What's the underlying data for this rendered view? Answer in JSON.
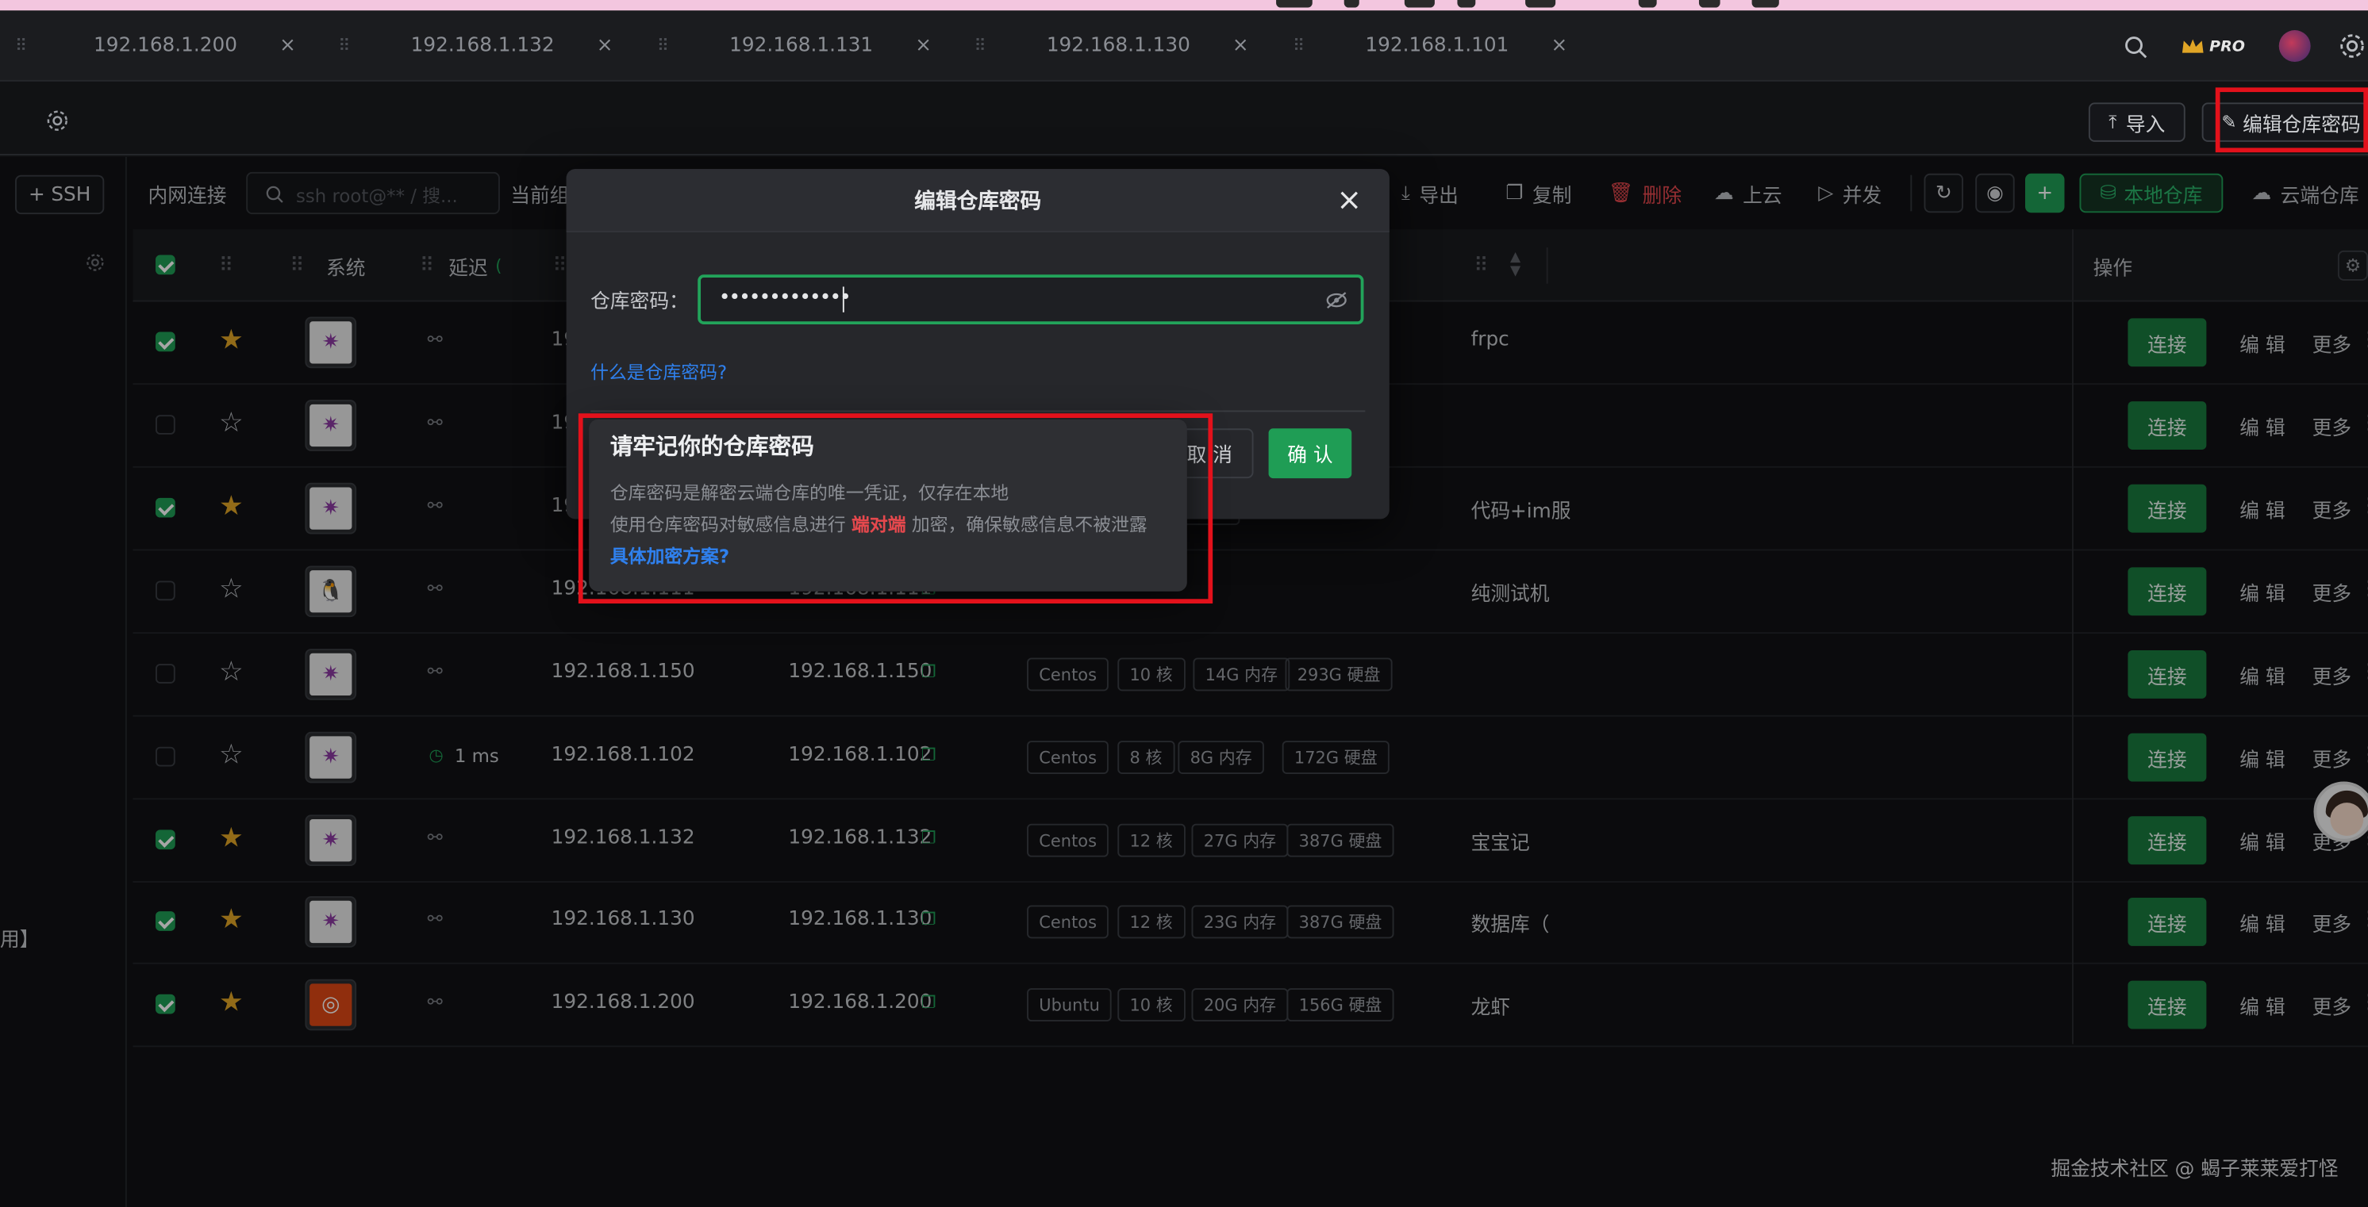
{
  "tabs": [
    {
      "label": "192.168.1.200"
    },
    {
      "label": "192.168.1.132"
    },
    {
      "label": "192.168.1.131"
    },
    {
      "label": "192.168.1.130"
    },
    {
      "label": "192.168.1.101"
    }
  ],
  "tab_close": "×",
  "topbar": {
    "pro_badge": "PRO",
    "import_label": "导入",
    "edit_pwd_label": "编辑仓库密码"
  },
  "left": {
    "ssh_button": "SSH",
    "partial_text": "用】"
  },
  "toolbar": {
    "intranet_label": "内网连接",
    "search_placeholder": "ssh root@** / 搜...",
    "group_label": "当前组",
    "export_label": "导出",
    "copy_label": "复制",
    "delete_label": "删除",
    "cloud_up_label": "上云",
    "concurrent_label": "并发",
    "local_repo_label": "本地仓库",
    "cloud_repo_label": "云端仓库"
  },
  "table": {
    "headers": {
      "system": "系统",
      "latency": "延迟",
      "operation": "操作"
    },
    "rows": [
      {
        "checked": true,
        "starred": true,
        "os": "CentOS",
        "latency": "",
        "host": "19",
        "ip": "",
        "tags": [],
        "note": "frpc"
      },
      {
        "checked": false,
        "starred": false,
        "os": "CentOS",
        "latency": "",
        "host": "19",
        "ip": "",
        "tags": [],
        "note": ""
      },
      {
        "checked": true,
        "starred": true,
        "os": "CentOS",
        "latency": "",
        "host": "192",
        "ip": "",
        "tags": [
          "39G 内存",
          "387G 硬盘"
        ],
        "note": "代码+im服"
      },
      {
        "checked": false,
        "starred": false,
        "os": "Linux",
        "latency": "",
        "host": "192.168.1.111",
        "ip": "192.168.1.111",
        "tags": [],
        "note": "纯测试机"
      },
      {
        "checked": false,
        "starred": false,
        "os": "CentOS",
        "latency": "",
        "host": "192.168.1.150",
        "ip": "192.168.1.150",
        "tags": [
          "Centos",
          "10 核",
          "14G 内存",
          "293G 硬盘"
        ],
        "note": ""
      },
      {
        "checked": false,
        "starred": false,
        "os": "CentOS",
        "latency": "1 ms",
        "host": "192.168.1.102",
        "ip": "192.168.1.102",
        "tags": [
          "Centos",
          "8 核",
          "8G 内存",
          "172G 硬盘"
        ],
        "note": ""
      },
      {
        "checked": true,
        "starred": true,
        "os": "CentOS",
        "latency": "",
        "host": "192.168.1.132",
        "ip": "192.168.1.132",
        "tags": [
          "Centos",
          "12 核",
          "27G 内存",
          "387G 硬盘"
        ],
        "note": "宝宝记"
      },
      {
        "checked": true,
        "starred": true,
        "os": "CentOS",
        "latency": "",
        "host": "192.168.1.130",
        "ip": "192.168.1.130",
        "tags": [
          "Centos",
          "12 核",
          "23G 内存",
          "387G 硬盘"
        ],
        "note": "数据库（"
      },
      {
        "checked": true,
        "starred": true,
        "os": "Ubuntu",
        "latency": "",
        "host": "192.168.1.200",
        "ip": "192.168.1.200",
        "tags": [
          "Ubuntu",
          "10 核",
          "20G 内存",
          "156G 硬盘"
        ],
        "note": "龙虾"
      }
    ],
    "connect_label": "连接",
    "edit_label": "编 辑",
    "more_label": "更多"
  },
  "modal": {
    "title": "编辑仓库密码",
    "close": "×",
    "pwd_label": "仓库密码：",
    "pwd_value": "•••••••••••••",
    "help_link": "什么是仓库密码?",
    "cancel_label": "取 消",
    "confirm_label": "确 认"
  },
  "popover": {
    "title": "请牢记你的仓库密码",
    "line1": "仓库密码是解密云端仓库的唯一凭证，仅存在本地",
    "line2_pre": "使用仓库密码对敏感信息进行",
    "line2_hl": "端对端",
    "line2_post": "加密，确保敏感信息不被泄露",
    "link": "具体加密方案?"
  },
  "watermark": "掘金技术社区 @ 蝎子莱莱爱打怪",
  "colors": {
    "accent": "#1f9d55",
    "highlight_box": "#e3111b",
    "danger": "#e5484d",
    "link": "#2f80ed",
    "star": "#e0a526"
  }
}
